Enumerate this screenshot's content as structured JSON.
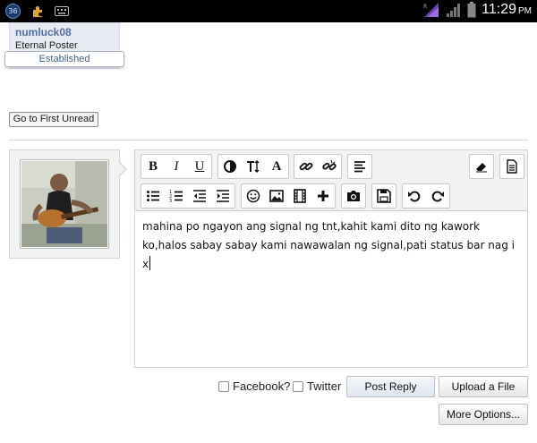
{
  "statusbar": {
    "badge_number": "36",
    "time": "11:29",
    "ampm": "PM"
  },
  "user": {
    "username": "numluck08",
    "title": "Eternal Poster",
    "badge": "Established"
  },
  "go_first_unread": "Go to First Unread",
  "editor": {
    "content": "mahina po ngayon ang signal ng tnt,kahit kami dito ng kawork ko,halos sabay sabay kami nawawalan ng signal,pati status bar nag i x"
  },
  "options": {
    "facebook_label": "Facebook?",
    "twitter_label": "Twitter"
  },
  "buttons": {
    "post_reply": "Post Reply",
    "upload_file": "Upload a File",
    "more_options": "More Options..."
  },
  "colors": {
    "username": "#4d6ea5",
    "statusbar_bg": "#000000"
  }
}
